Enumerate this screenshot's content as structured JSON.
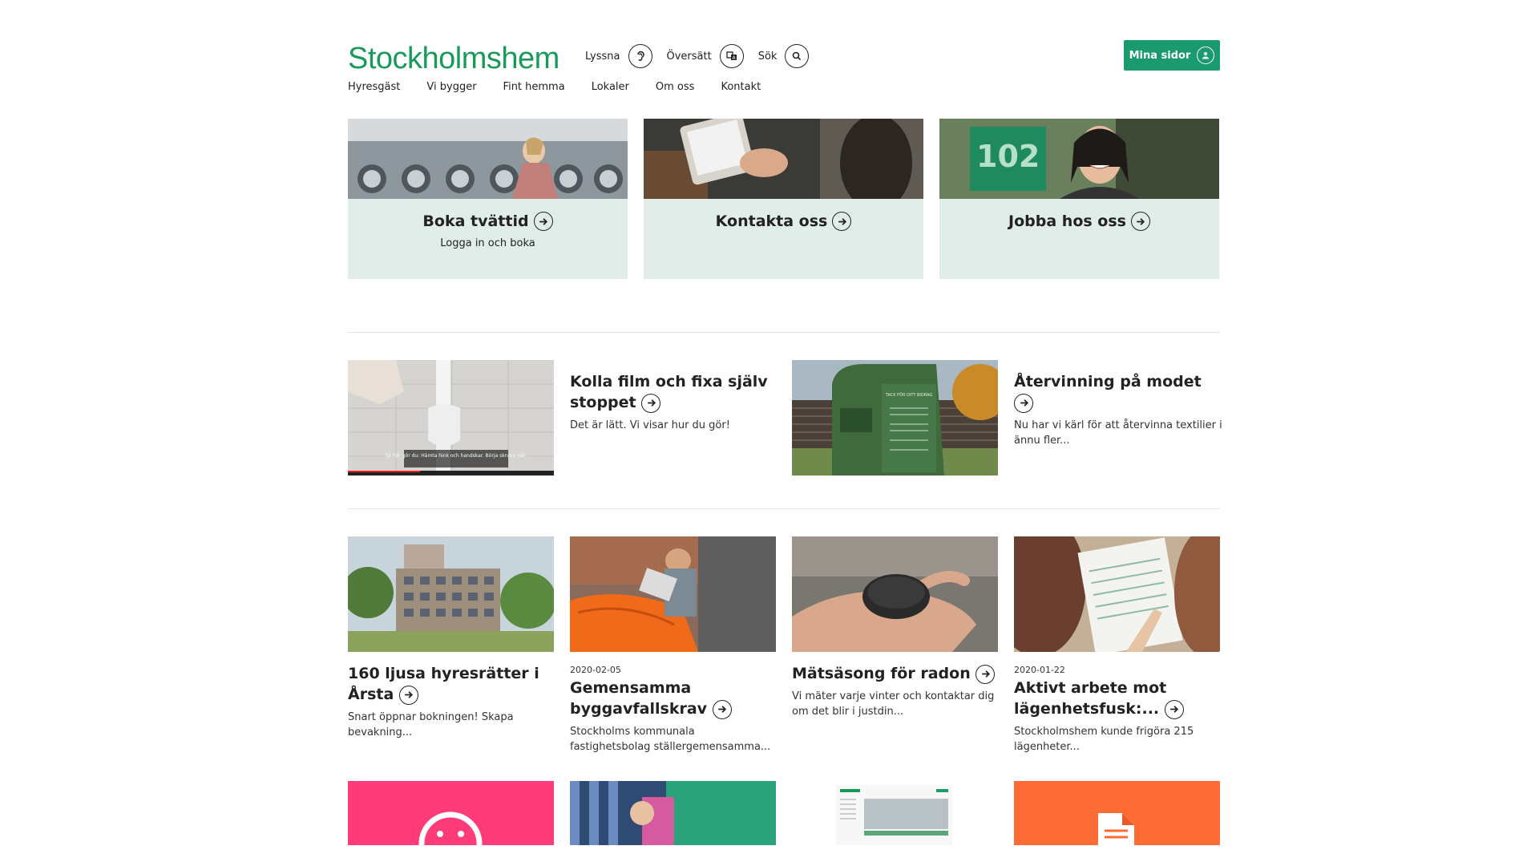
{
  "header": {
    "logo": "Stockholmshem",
    "tools": [
      {
        "label": "Lyssna",
        "icon": "ear-icon"
      },
      {
        "label": "Översätt",
        "icon": "translate-icon"
      },
      {
        "label": "Sök",
        "icon": "search-icon"
      }
    ],
    "account_button": "Mina sidor"
  },
  "nav": [
    "Hyresgäst",
    "Vi bygger",
    "Fint hemma",
    "Lokaler",
    "Om oss",
    "Kontakt"
  ],
  "top_cards": [
    {
      "title": "Boka tvättid",
      "sub": "Logga in och boka"
    },
    {
      "title": "Kontakta oss",
      "sub": ""
    },
    {
      "title": "Jobba hos oss",
      "sub": "",
      "image_text": "102"
    }
  ],
  "features": [
    {
      "title": "Kolla film och fixa själv stoppet",
      "desc": "Det är lätt. Vi visar hur du gör!",
      "caption": "Så här gör du: Hämta hink och handskar. Börja skruva isär."
    },
    {
      "title": "Återvinning på modet",
      "desc": "Nu har vi kärl för att återvinna textilier i ännu fler...",
      "sign_text": "TACK FÖR DITT BIDRAG"
    }
  ],
  "news": [
    {
      "date": "",
      "title": "160 ljusa hyresrätter i Årsta",
      "desc": "Snart öppnar bokningen! Skapa bevakning..."
    },
    {
      "date": "2020-02-05",
      "title": "Gemensamma byggavfallskrav",
      "desc": "Stockholms kommunala fastighetsbolag ställergemensamma..."
    },
    {
      "date": "",
      "title": "Mätsäsong för radon",
      "desc": "Vi mäter varje vinter och kontaktar dig om det blir i justdin..."
    },
    {
      "date": "2020-01-22",
      "title": "Aktivt arbete mot lägenhetsfusk:...",
      "desc": "Stockholmshem kunde frigöra 215 lägenheter..."
    }
  ],
  "colors": {
    "brand": "#1a9a5a",
    "button": "#1a9a6e",
    "card_bg": "#e0ede8",
    "pink": "#ff3b7a",
    "orange": "#ff6b35"
  }
}
